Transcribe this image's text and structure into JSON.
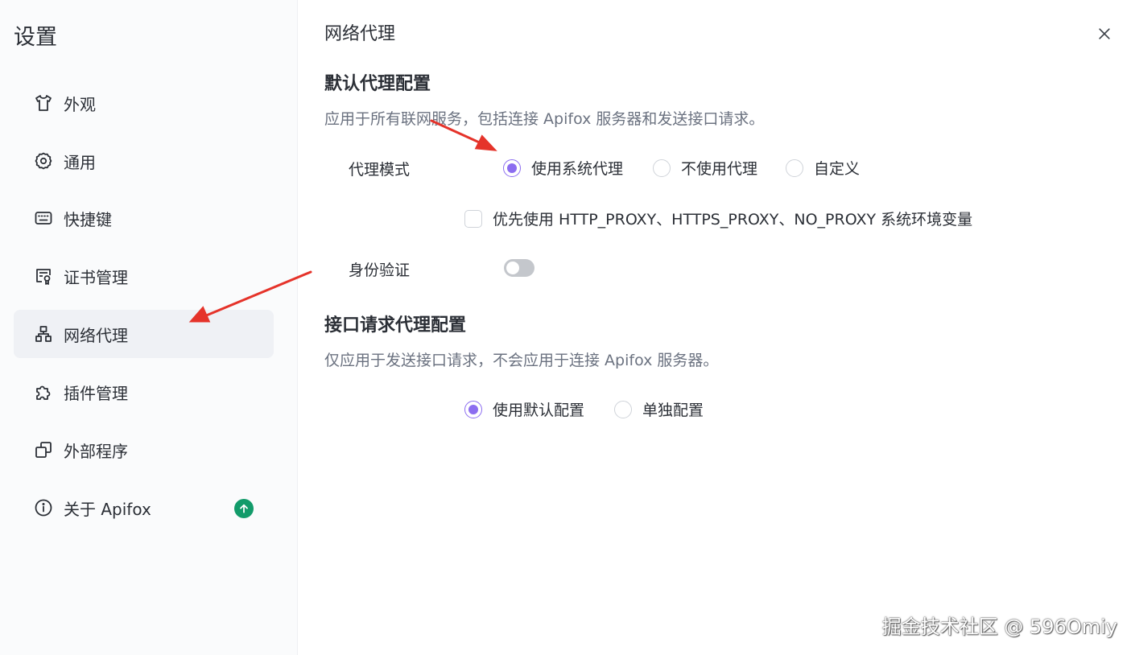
{
  "sidebar": {
    "title": "设置",
    "items": [
      {
        "label": "外观",
        "icon": "shirt-icon"
      },
      {
        "label": "通用",
        "icon": "gear-icon"
      },
      {
        "label": "快捷键",
        "icon": "keyboard-icon"
      },
      {
        "label": "证书管理",
        "icon": "certificate-icon"
      },
      {
        "label": "网络代理",
        "icon": "network-icon",
        "active": true
      },
      {
        "label": "插件管理",
        "icon": "puzzle-icon"
      },
      {
        "label": "外部程序",
        "icon": "external-program-icon"
      },
      {
        "label": "关于 Apifox",
        "icon": "info-icon",
        "badge": "update-arrow-icon"
      }
    ]
  },
  "main": {
    "page_title": "网络代理",
    "default_proxy": {
      "title": "默认代理配置",
      "description": "应用于所有联网服务，包括连接 Apifox 服务器和发送接口请求。",
      "proxy_mode_label": "代理模式",
      "proxy_mode_options": [
        "使用系统代理",
        "不使用代理",
        "自定义"
      ],
      "proxy_mode_selected": "使用系统代理",
      "env_checkbox_label": "优先使用 HTTP_PROXY、HTTPS_PROXY、NO_PROXY 系统环境变量",
      "env_checkbox_checked": false,
      "auth_label": "身份验证",
      "auth_enabled": false
    },
    "request_proxy": {
      "title": "接口请求代理配置",
      "description": "仅应用于发送接口请求，不会应用于连接 Apifox 服务器。",
      "options": [
        "使用默认配置",
        "单独配置"
      ],
      "selected": "使用默认配置"
    }
  },
  "watermark": "掘金技术社区 @ 596Omiy",
  "colors": {
    "accent": "#8c6df0",
    "badge": "#129b6a",
    "annotation": "#e5332a"
  }
}
